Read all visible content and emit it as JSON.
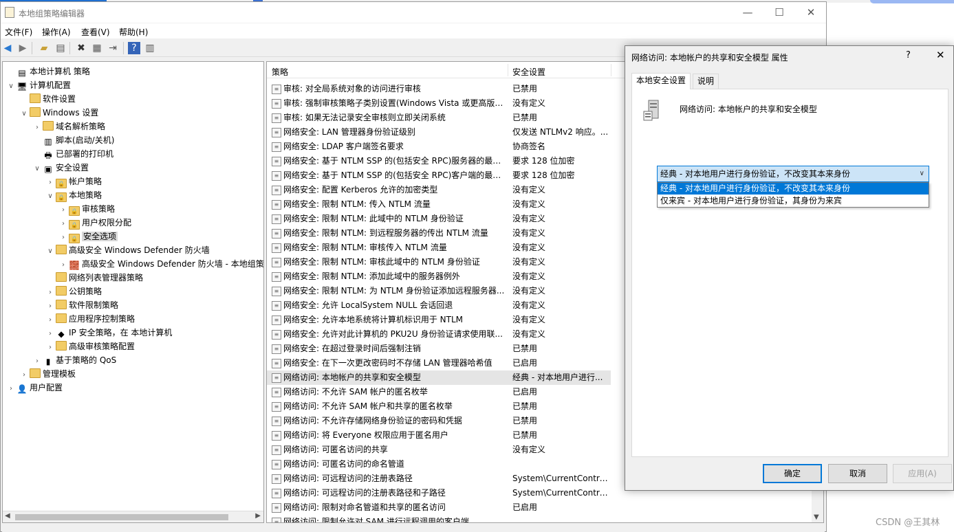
{
  "window": {
    "title": "本地组策略编辑器"
  },
  "menu": [
    "文件(F)",
    "操作(A)",
    "查看(V)",
    "帮助(H)"
  ],
  "tree": [
    {
      "label": "本地计算机 策略",
      "level": 0,
      "toggle": "",
      "icon": "document-icon"
    },
    {
      "label": "计算机配置",
      "level": 0,
      "toggle": "∨",
      "icon": "computer-icon"
    },
    {
      "label": "软件设置",
      "level": 1,
      "toggle": "",
      "icon": "folder-icon"
    },
    {
      "label": "Windows 设置",
      "level": 1,
      "toggle": "∨",
      "icon": "folder-icon"
    },
    {
      "label": "域名解析策略",
      "level": 2,
      "toggle": "›",
      "icon": "folder-icon"
    },
    {
      "label": "脚本(启动/关机)",
      "level": 2,
      "toggle": "",
      "icon": "script-icon"
    },
    {
      "label": "已部署的打印机",
      "level": 2,
      "toggle": "",
      "icon": "printer-icon"
    },
    {
      "label": "安全设置",
      "level": 2,
      "toggle": "∨",
      "icon": "security-icon"
    },
    {
      "label": "帐户策略",
      "level": 3,
      "toggle": "›",
      "icon": "lock-folder-icon"
    },
    {
      "label": "本地策略",
      "level": 3,
      "toggle": "∨",
      "icon": "lock-folder-icon"
    },
    {
      "label": "审核策略",
      "level": 4,
      "toggle": "›",
      "icon": "lock-folder-icon"
    },
    {
      "label": "用户权限分配",
      "level": 4,
      "toggle": "›",
      "icon": "lock-folder-icon"
    },
    {
      "label": "安全选项",
      "level": 4,
      "toggle": "›",
      "icon": "lock-folder-icon",
      "selected": true
    },
    {
      "label": "高级安全 Windows Defender 防火墙",
      "level": 3,
      "toggle": "∨",
      "icon": "folder-icon"
    },
    {
      "label": "高级安全 Windows Defender 防火墙 - 本地组策",
      "level": 4,
      "toggle": "›",
      "icon": "firewall-icon"
    },
    {
      "label": "网络列表管理器策略",
      "level": 3,
      "toggle": "",
      "icon": "folder-icon"
    },
    {
      "label": "公钥策略",
      "level": 3,
      "toggle": "›",
      "icon": "folder-icon"
    },
    {
      "label": "软件限制策略",
      "level": 3,
      "toggle": "›",
      "icon": "folder-icon"
    },
    {
      "label": "应用程序控制策略",
      "level": 3,
      "toggle": "›",
      "icon": "folder-icon"
    },
    {
      "label": "IP 安全策略，在 本地计算机",
      "level": 3,
      "toggle": "›",
      "icon": "ipsec-icon"
    },
    {
      "label": "高级审核策略配置",
      "level": 3,
      "toggle": "›",
      "icon": "folder-icon"
    },
    {
      "label": "基于策略的 QoS",
      "level": 2,
      "toggle": "›",
      "icon": "chart-icon"
    },
    {
      "label": "管理模板",
      "level": 1,
      "toggle": "›",
      "icon": "folder-icon"
    },
    {
      "label": "用户配置",
      "level": 0,
      "toggle": "›",
      "icon": "user-icon"
    }
  ],
  "list": {
    "col_policy": "策略",
    "col_setting": "安全设置",
    "rows": [
      {
        "policy": "审核: 对全局系统对象的访问进行审核",
        "setting": "已禁用"
      },
      {
        "policy": "审核: 强制审核策略子类别设置(Windows Vista 或更高版本...",
        "setting": "没有定义"
      },
      {
        "policy": "审核: 如果无法记录安全审核则立即关闭系统",
        "setting": "已禁用"
      },
      {
        "policy": "网络安全: LAN 管理器身份验证级别",
        "setting": "仅发送 NTLMv2 响应。..."
      },
      {
        "policy": "网络安全: LDAP 客户端签名要求",
        "setting": "协商签名"
      },
      {
        "policy": "网络安全: 基于 NTLM SSP 的(包括安全 RPC)服务器的最小...",
        "setting": "要求 128 位加密"
      },
      {
        "policy": "网络安全: 基于 NTLM SSP 的(包括安全 RPC)客户端的最小...",
        "setting": "要求 128 位加密"
      },
      {
        "policy": "网络安全: 配置 Kerberos 允许的加密类型",
        "setting": "没有定义"
      },
      {
        "policy": "网络安全: 限制 NTLM: 传入 NTLM 流量",
        "setting": "没有定义"
      },
      {
        "policy": "网络安全: 限制 NTLM: 此域中的 NTLM 身份验证",
        "setting": "没有定义"
      },
      {
        "policy": "网络安全: 限制 NTLM: 到远程服务器的传出 NTLM 流量",
        "setting": "没有定义"
      },
      {
        "policy": "网络安全: 限制 NTLM: 审核传入 NTLM 流量",
        "setting": "没有定义"
      },
      {
        "policy": "网络安全: 限制 NTLM: 审核此域中的 NTLM 身份验证",
        "setting": "没有定义"
      },
      {
        "policy": "网络安全: 限制 NTLM: 添加此域中的服务器例外",
        "setting": "没有定义"
      },
      {
        "policy": "网络安全: 限制 NTLM: 为 NTLM 身份验证添加远程服务器...",
        "setting": "没有定义"
      },
      {
        "policy": "网络安全: 允许 LocalSystem NULL 会话回退",
        "setting": "没有定义"
      },
      {
        "policy": "网络安全: 允许本地系统将计算机标识用于 NTLM",
        "setting": "没有定义"
      },
      {
        "policy": "网络安全: 允许对此计算机的 PKU2U 身份验证请求使用联...",
        "setting": "没有定义"
      },
      {
        "policy": "网络安全: 在超过登录时间后强制注销",
        "setting": "已禁用"
      },
      {
        "policy": "网络安全: 在下一次更改密码时不存储 LAN 管理器哈希值",
        "setting": "已启用"
      },
      {
        "policy": "网络访问: 本地帐户的共享和安全模型",
        "setting": "经典 - 对本地用户进行...",
        "highlight": true
      },
      {
        "policy": "网络访问: 不允许 SAM 帐户的匿名枚举",
        "setting": "已启用"
      },
      {
        "policy": "网络访问: 不允许 SAM 帐户和共享的匿名枚举",
        "setting": "已禁用"
      },
      {
        "policy": "网络访问: 不允许存储网络身份验证的密码和凭据",
        "setting": "已禁用"
      },
      {
        "policy": "网络访问: 将 Everyone 权限应用于匿名用户",
        "setting": "已禁用"
      },
      {
        "policy": "网络访问: 可匿名访问的共享",
        "setting": "没有定义"
      },
      {
        "policy": "网络访问: 可匿名访问的命名管道",
        "setting": ""
      },
      {
        "policy": "网络访问: 可远程访问的注册表路径",
        "setting": "System\\CurrentContro..."
      },
      {
        "policy": "网络访问: 可远程访问的注册表路径和子路径",
        "setting": "System\\CurrentContro..."
      },
      {
        "policy": "网络访问: 限制对命名管道和共享的匿名访问",
        "setting": "已启用"
      },
      {
        "policy": "网络访问: 限制允许对 SAM 进行远程调用的客户端",
        "setting": ""
      }
    ]
  },
  "dialog": {
    "title": "网络访问: 本地帐户的共享和安全模型 属性",
    "help": "?",
    "close": "✕",
    "tabs": [
      "本地安全设置",
      "说明"
    ],
    "policy_name": "网络访问: 本地帐户的共享和安全模型",
    "combo_value": "经典 - 对本地用户进行身份验证，不改变其本来身份",
    "options": [
      "经典 - 对本地用户进行身份验证，不改变其本来身份",
      "仅来宾 - 对本地用户进行身份验证，其身份为来宾"
    ],
    "ok": "确定",
    "cancel": "取消",
    "apply": "应用(A)"
  },
  "watermark": "CSDN @王其林"
}
